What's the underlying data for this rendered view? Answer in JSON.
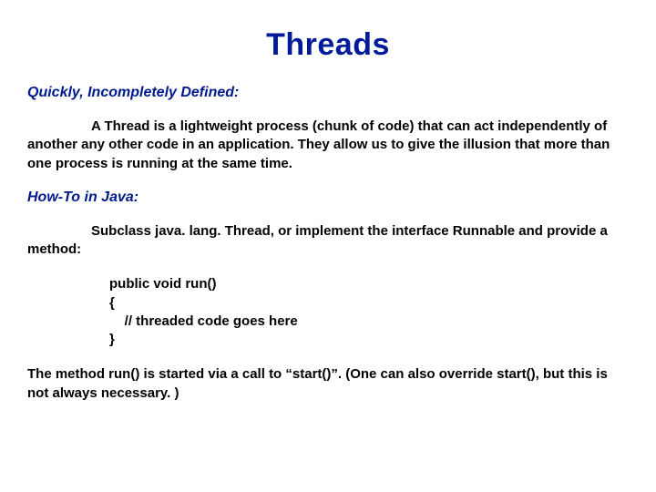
{
  "title": "Threads",
  "section1": {
    "heading": "Quickly, Incompletely Defined:",
    "body": "A Thread is a lightweight process (chunk of code) that can act independently of another any other code in an application.  They allow us to give the illusion that more than one process is running at the same time."
  },
  "section2": {
    "heading": "How-To in Java:",
    "body": "Subclass java. lang. Thread, or implement the interface Runnable and provide a method:",
    "code": "public void run()\n{\n    // threaded code goes here\n}",
    "footer": "The method run() is started via a call to “start()”.  (One can also override start(), but this is not always necessary. )"
  }
}
